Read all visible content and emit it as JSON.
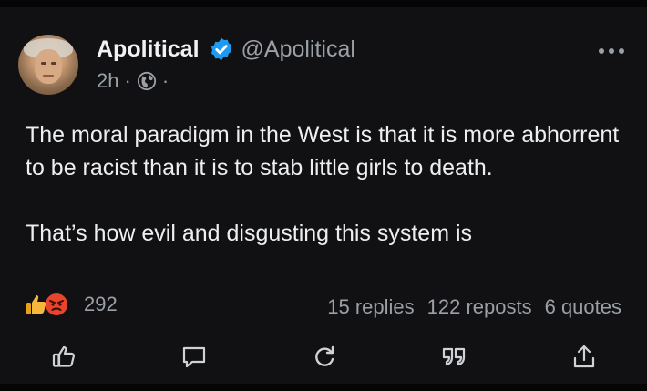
{
  "post": {
    "author_name": "Apolitical",
    "handle": "@Apolitical",
    "time": "2h",
    "separator": "·",
    "paragraphs": [
      "The moral paradigm in the West is that it is more abhorrent to be racist than it is to stab little girls to death.",
      "That’s how evil and disgusting this system is"
    ],
    "reaction_count": "292",
    "stats": {
      "replies": "15 replies",
      "reposts": "122 reposts",
      "quotes": "6 quotes"
    }
  },
  "icons": {
    "verified": "verified-check-icon",
    "privacy": "globe-icon",
    "more": "more-dots-icon",
    "reaction_1": "thumbs-up-emoji",
    "reaction_2": "angry-face-emoji",
    "like": "thumbs-up-icon",
    "comment": "comment-bubble-icon",
    "repost": "repost-icon",
    "quote": "quote-icon",
    "share": "share-icon"
  },
  "colors": {
    "background": "#111113",
    "text": "#eceeef",
    "muted": "#9aa0a6",
    "verified_blue": "#1d9bf0"
  }
}
